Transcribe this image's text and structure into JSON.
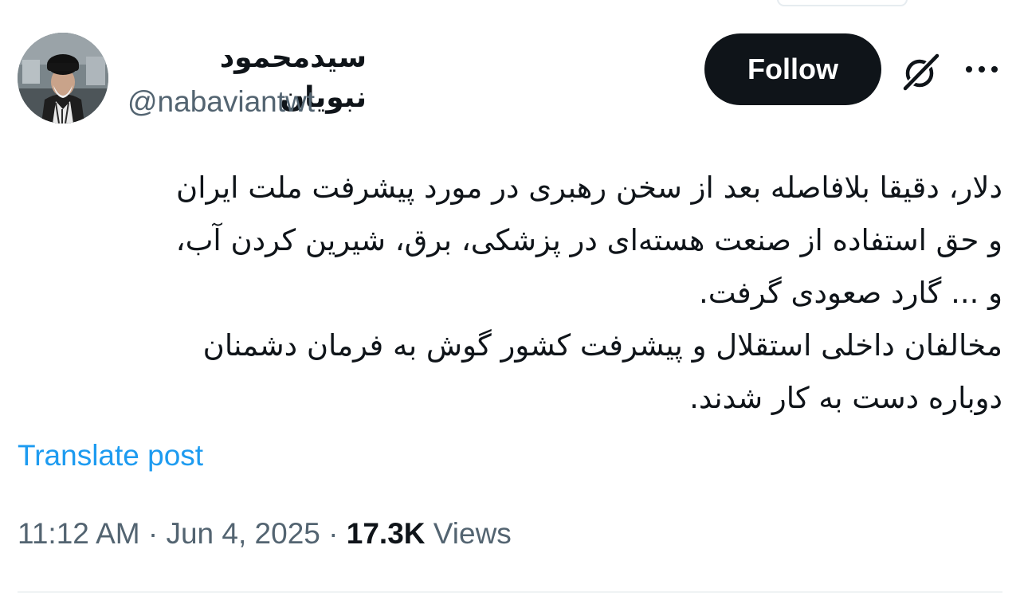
{
  "author": {
    "display_name": "سیدمحمود نبویان",
    "handle": "@nabaviantwt"
  },
  "header": {
    "follow_label": "Follow"
  },
  "icons": {
    "grok": "grok-icon",
    "more": "more-options-icon",
    "avatar": "avatar"
  },
  "tweet": {
    "lines": [
      "دلار، دقیقا بلافاصله بعد از سخن رهبری در مورد پیشرفت ملت ایران",
      "و حق استفاده از صنعت هسته‌ای در پزشکی، برق، شیرین کردن آب،",
      "و ... گارد صعودی گرفت.",
      "مخالفان داخلی استقلال و پیشرفت کشور گوش به فرمان دشمنان",
      "دوباره دست به کار شدند."
    ],
    "translate_label": "Translate post"
  },
  "meta": {
    "time": "11:12 AM",
    "sep1": "·",
    "date": "Jun 4, 2025",
    "sep2": "·",
    "views_count": "17.3K",
    "views_label": "Views"
  },
  "colors": {
    "text": "#0f1419",
    "muted": "#536471",
    "link": "#1d9bf0",
    "button_bg": "#0f1419",
    "button_text": "#ffffff"
  }
}
